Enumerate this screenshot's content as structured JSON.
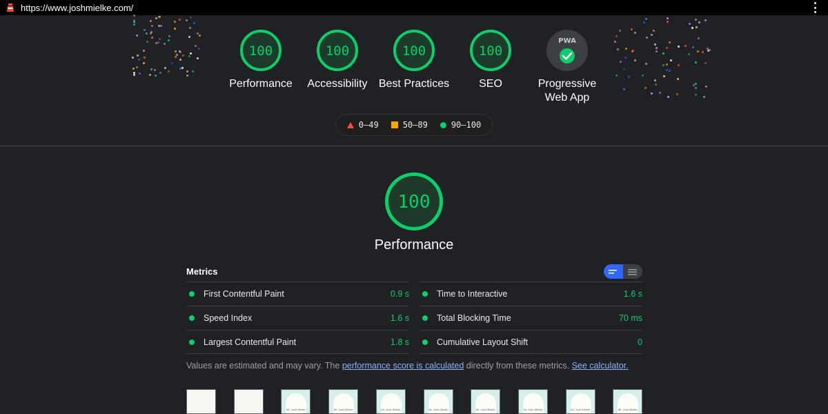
{
  "browser": {
    "url": "https://www.joshmielke.com/"
  },
  "categories": [
    {
      "score": "100",
      "label": "Performance"
    },
    {
      "score": "100",
      "label": "Accessibility"
    },
    {
      "score": "100",
      "label": "Best Practices"
    },
    {
      "score": "100",
      "label": "SEO"
    }
  ],
  "pwa": {
    "badge": "PWA",
    "label": "Progressive Web App"
  },
  "legend": {
    "low": "0–49",
    "mid": "50–89",
    "high": "90–100"
  },
  "section": {
    "score": "100",
    "title": "Performance"
  },
  "metrics": {
    "heading": "Metrics",
    "left": [
      {
        "name": "First Contentful Paint",
        "value": "0.9 s"
      },
      {
        "name": "Speed Index",
        "value": "1.6 s"
      },
      {
        "name": "Largest Contentful Paint",
        "value": "1.8 s"
      }
    ],
    "right": [
      {
        "name": "Time to Interactive",
        "value": "1.6 s"
      },
      {
        "name": "Total Blocking Time",
        "value": "70 ms"
      },
      {
        "name": "Cumulative Layout Shift",
        "value": "0"
      }
    ]
  },
  "note": {
    "prefix": "Values are estimated and may vary. The ",
    "link1": "performance score is calculated",
    "middle": " directly from these metrics. ",
    "link2": "See calculator."
  },
  "filmstrip": {
    "frame_caption": "Mr. Josh Mielke"
  },
  "colors": {
    "pass": "#0cce6b",
    "average": "#ffa400",
    "fail": "#ff4e42",
    "accent": "#2f67ff"
  }
}
